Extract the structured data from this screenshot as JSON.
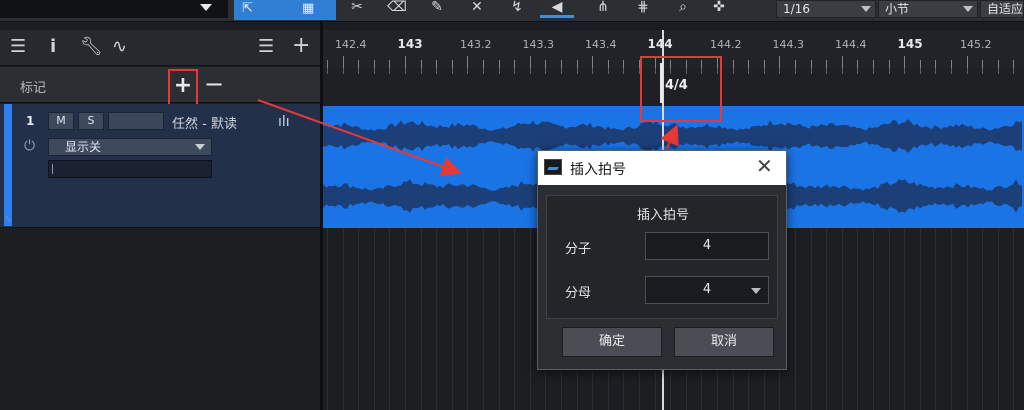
{
  "toolbar": {
    "quantize_value": "1/16",
    "timebase_value": "小节",
    "snap_value": "自适应",
    "tool_icons": [
      "arrow-tool-icon",
      "range-tool-icon",
      "split-tool-icon",
      "eraser-tool-icon",
      "paint-tool-icon",
      "mute-tool-icon",
      "bend-tool-icon",
      "listen-tool-icon"
    ]
  },
  "left_panel": {
    "marker_label": "标记",
    "marker_add": "+",
    "marker_remove": "−",
    "track": {
      "number": "1",
      "mute_label": "M",
      "solo_label": "S",
      "name": "任然 - 默读",
      "display_mode": "显示关"
    }
  },
  "ruler": {
    "labels": [
      "142.4",
      "143",
      "143.2",
      "143.3",
      "143.4",
      "144",
      "144.2",
      "144.3",
      "144.4",
      "145",
      "145.2"
    ]
  },
  "signature_marker": {
    "text": "4/4"
  },
  "dialog": {
    "title": "插入拍号",
    "heading": "插入拍号",
    "numerator_label": "分子",
    "numerator_value": "4",
    "denominator_label": "分母",
    "denominator_value": "4",
    "ok_label": "确定",
    "cancel_label": "取消"
  },
  "colors": {
    "annotation": "#e53935",
    "event_blue": "#1b74e6",
    "accent": "#2f80ed"
  }
}
